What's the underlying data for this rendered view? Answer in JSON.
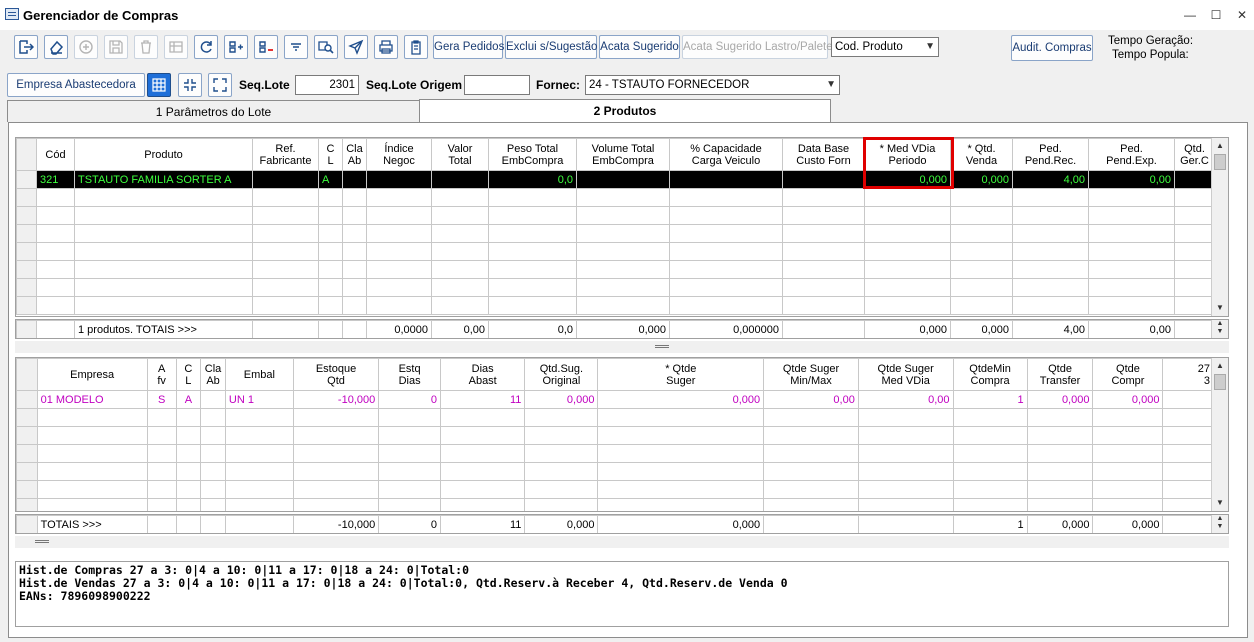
{
  "window": {
    "title": "Gerenciador de Compras",
    "min": "—",
    "max": "☐",
    "close": "✕"
  },
  "toolbar": {
    "gera_pedidos": "Gera Pedidos",
    "exclui_sugestao": "Exclui s/Sugestão",
    "acata_sugerido": "Acata Sugerido",
    "acata_lastro": "Acata Sugerido Lastro/Palete",
    "cod_produto": "Cod. Produto",
    "audit_compras": "Audit. Compras",
    "tempo_geracao": "Tempo Geração:",
    "tempo_popula": "Tempo Popula:"
  },
  "filters": {
    "empresa_btn": "Empresa Abastecedora",
    "seq_lote_label": "Seq.Lote",
    "seq_lote_value": "2301",
    "seq_lote_origem_label": "Seq.Lote Origem",
    "seq_lote_origem_value": "",
    "fornec_label": "Fornec:",
    "fornec_value": "24 - TSTAUTO FORNECEDOR"
  },
  "tabs": [
    {
      "label": "1  Parâmetros do Lote"
    },
    {
      "label": "2  Produtos"
    }
  ],
  "grid1": {
    "headers": [
      "Cód",
      "Produto",
      "Ref.\nFabricante",
      "C\nL",
      "Cla\nAb",
      "Índice\nNegoc",
      "Valor\nTotal",
      "Peso Total\nEmbCompra",
      "Volume Total\nEmbCompra",
      "% Capacidade\nCarga Veiculo",
      "Data Base\nCusto Forn",
      "* Med VDia\nPeriodo",
      "* Qtd.\nVenda",
      "Ped.\nPend.Rec.",
      "Ped.\nPend.Exp.",
      "Qtd.\nGer.C"
    ],
    "row": [
      "321",
      "TSTAUTO FAMILIA SORTER A",
      "",
      "A",
      "",
      "",
      "",
      "0,0",
      "",
      "",
      "",
      "0,000",
      "0,000",
      "4,00",
      "0,00",
      ""
    ],
    "totals": [
      "",
      "1 produtos. TOTAIS >>>",
      "",
      "",
      "",
      "0,0000",
      "0,00",
      "0,0",
      "0,000",
      "0,000000",
      "",
      "0,000",
      "0,000",
      "4,00",
      "0,00",
      ""
    ]
  },
  "grid2": {
    "headers": [
      "Empresa",
      "A\nfv",
      "C\nL",
      "Cla\nAb",
      "Embal",
      "Estoque\nQtd",
      "Estq\nDias",
      "Dias\nAbast",
      "Qtd.Sug.\nOriginal",
      "* Qtde\nSuger",
      "Qtde Suger\nMin/Max",
      "Qtde Suger\nMed VDia",
      "QtdeMin\nCompra",
      "Qtde\nTransfer",
      "Qtde\nCompr",
      "27\n3"
    ],
    "row": [
      "01 MODELO",
      "S",
      "A",
      "",
      "UN 1",
      "-10,000",
      "0",
      "11",
      "0,000",
      "0,000",
      "0,00",
      "0,00",
      "1",
      "0,000",
      "0,000",
      ""
    ],
    "totals": [
      "TOTAIS >>>",
      "",
      "",
      "",
      "",
      "-10,000",
      "0",
      "11",
      "0,000",
      "0,000",
      "",
      "",
      "1",
      "0,000",
      "0,000",
      ""
    ]
  },
  "memo": [
    "Hist.de Compras 27 a 3: 0|4 a 10: 0|11 a 17: 0|18 a 24: 0|Total:0",
    "Hist.de Vendas 27 a 3: 0|4 a 10: 0|11 a 17: 0|18 a 24: 0|Total:0, Qtd.Reserv.à Receber 4, Qtd.Reserv.de Venda 0",
    "EANs: 7896098900222"
  ]
}
